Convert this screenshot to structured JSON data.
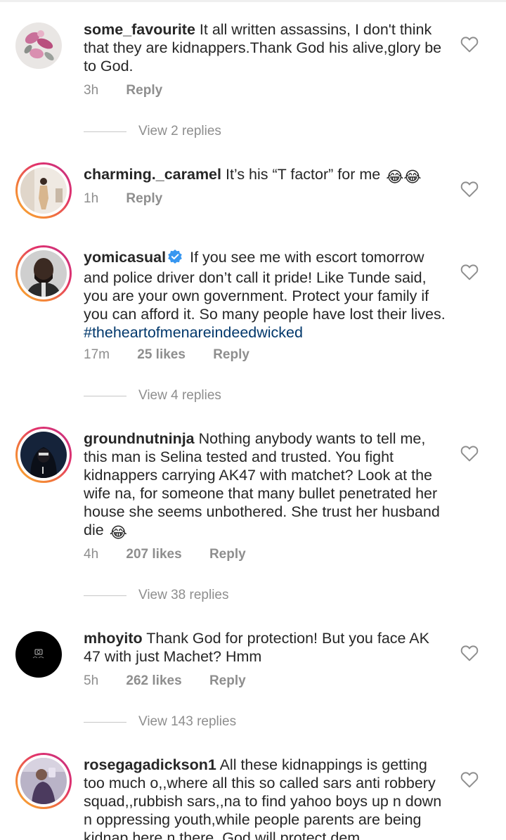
{
  "comments": [
    {
      "username": "some_favourite",
      "text": "It all written assassins, I don't think that they are kidnappers.Thank God his alive,glory be to God.",
      "time": "3h",
      "likes": "",
      "reply_label": "Reply",
      "view_replies": "View 2 replies",
      "avatar_icon": "floral-avatar"
    },
    {
      "username": "charming._caramel",
      "text": "It’s his “T factor” for me",
      "emoji": "😂😂",
      "time": "1h",
      "likes": "",
      "reply_label": "Reply",
      "view_replies": "",
      "avatar_icon": "person-avatar"
    },
    {
      "username": "yomicasual",
      "verified": true,
      "text": "If you see me with escort tomorrow and police driver don’t call it pride! Like Tunde said, you are your own government. Protect your family if you can afford it. So many people have lost their lives.",
      "hashtag": "#theheartofmenareindeedwicked",
      "time": "17m",
      "likes": "25 likes",
      "reply_label": "Reply",
      "view_replies": "View 4 replies",
      "avatar_icon": "portrait-avatar"
    },
    {
      "username": "groundnutninja",
      "text": "Nothing anybody wants to tell me, this man is Selina tested and trusted. You fight kidnappers carrying AK47 with matchet? Look at the wife na, for someone that many bullet penetrated her house she seems unbothered. She trust her husband die",
      "emoji": "😂",
      "time": "4h",
      "likes": "207 likes",
      "reply_label": "Reply",
      "view_replies": "View 38 replies",
      "avatar_icon": "hooded-avatar"
    },
    {
      "username": "mhoyito",
      "text": "Thank God for protection! But you face AK 47 with just Machet? Hmm",
      "time": "5h",
      "likes": "262 likes",
      "reply_label": "Reply",
      "view_replies": "View 143 replies",
      "avatar_icon": "dark-logo-avatar"
    },
    {
      "username": "rosegagadickson1",
      "text": "All these kidnappings is getting too much o,,where all this so called sars anti robbery squad,,rubbish sars,,na to find yahoo boys up n down n oppressing youth,while people parents are being kidnap here n there. God will protect dem",
      "time": "",
      "likes": "",
      "reply_label": "",
      "view_replies": "",
      "avatar_icon": "selfie-avatar"
    }
  ],
  "colors": {
    "text": "#262626",
    "meta": "#8e8e8e",
    "hashtag": "#00376b",
    "verified": "#3897f0",
    "story_ring": "#e1306c"
  }
}
